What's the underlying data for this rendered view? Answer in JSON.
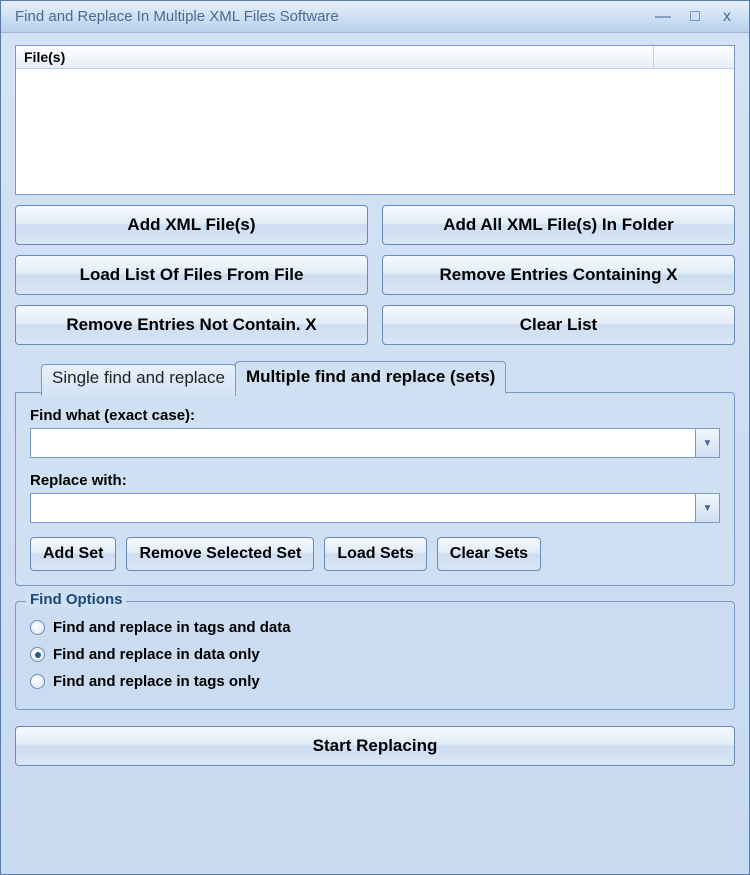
{
  "window": {
    "title": "Find and Replace In Multiple XML Files Software"
  },
  "file_list": {
    "header": "File(s)"
  },
  "buttons": {
    "add_xml": "Add XML File(s)",
    "add_all_folder": "Add All XML File(s) In Folder",
    "load_list": "Load List Of Files From File",
    "remove_containing": "Remove Entries Containing X",
    "remove_not_containing": "Remove Entries Not Contain. X",
    "clear_list": "Clear List"
  },
  "tabs": {
    "single": "Single find and replace",
    "multiple": "Multiple find and replace (sets)"
  },
  "fields": {
    "find_label": "Find what (exact case):",
    "find_value": "",
    "replace_label": "Replace with:",
    "replace_value": ""
  },
  "set_buttons": {
    "add": "Add Set",
    "remove": "Remove Selected Set",
    "load": "Load Sets",
    "clear": "Clear Sets"
  },
  "find_options": {
    "legend": "Find Options",
    "opt_tags_data": "Find and replace in tags and data",
    "opt_data_only": "Find and replace in data only",
    "opt_tags_only": "Find and replace in tags only",
    "selected": "data_only"
  },
  "start": "Start Replacing"
}
